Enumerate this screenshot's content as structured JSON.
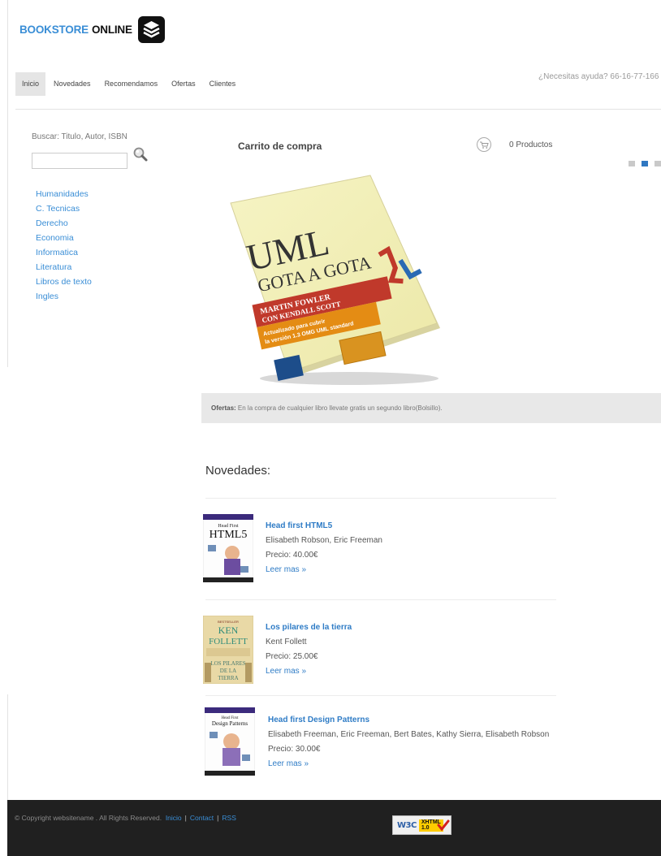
{
  "brand": {
    "name_part1": "BOOKSTORE",
    "name_part2": "ONLINE"
  },
  "nav": {
    "items": [
      {
        "label": "Inicio",
        "active": true
      },
      {
        "label": "Novedades"
      },
      {
        "label": "Recomendamos"
      },
      {
        "label": "Ofertas"
      },
      {
        "label": "Clientes"
      }
    ],
    "help_text": "¿Necesitas ayuda? 66-16-77-166"
  },
  "search": {
    "label": "Buscar: Titulo, Autor, ISBN",
    "value": ""
  },
  "categories": [
    "Humanidades",
    "C. Tecnicas",
    "Derecho",
    "Economia",
    "Informatica",
    "Literatura",
    "Libros de texto",
    "Ingles"
  ],
  "cart": {
    "title": "Carrito de compra",
    "count_text": "0 Productos"
  },
  "hero": {
    "title_line1": "UML",
    "title_line2": "GOTA A GOTA",
    "author1": "MARTIN FOWLER",
    "author2": "CON KENDALL SCOTT",
    "subtitle1": "Actualizado para cubrir",
    "subtitle2": "la versión 1.3 OMG UML standard"
  },
  "offer": {
    "label": "Ofertas:",
    "text": " En la compra de cualquier libro llevate gratis un segundo libro(Bolsillo)."
  },
  "novedades": {
    "heading": "Novedades:",
    "books": [
      {
        "title": "Head first HTML5",
        "authors": "Elisabeth Robson, Eric Freeman",
        "price": "Precio: 40.00€",
        "more": "Leer mas »"
      },
      {
        "title": "Los pilares de la tierra",
        "authors": "Kent Follett",
        "price": "Precio: 25.00€",
        "more": "Leer mas »"
      },
      {
        "title": "Head first Design Patterns",
        "authors": "Elisabeth Freeman, Eric Freeman, Bert Bates, Kathy Sierra, Elisabeth Robson",
        "price": "Precio: 30.00€",
        "more": "Leer mas »"
      }
    ]
  },
  "footer": {
    "copyright": "© Copyright websitename . All Rights Reserved.",
    "links": [
      "Inicio",
      "Contact",
      "RSS"
    ],
    "badge_left": "W3C",
    "badge_right1": "XHTML",
    "badge_right2": "1.0"
  },
  "colors": {
    "accent": "#3a8ed6",
    "footer_bg": "#202020",
    "offer_bg": "#e8e8e8"
  }
}
